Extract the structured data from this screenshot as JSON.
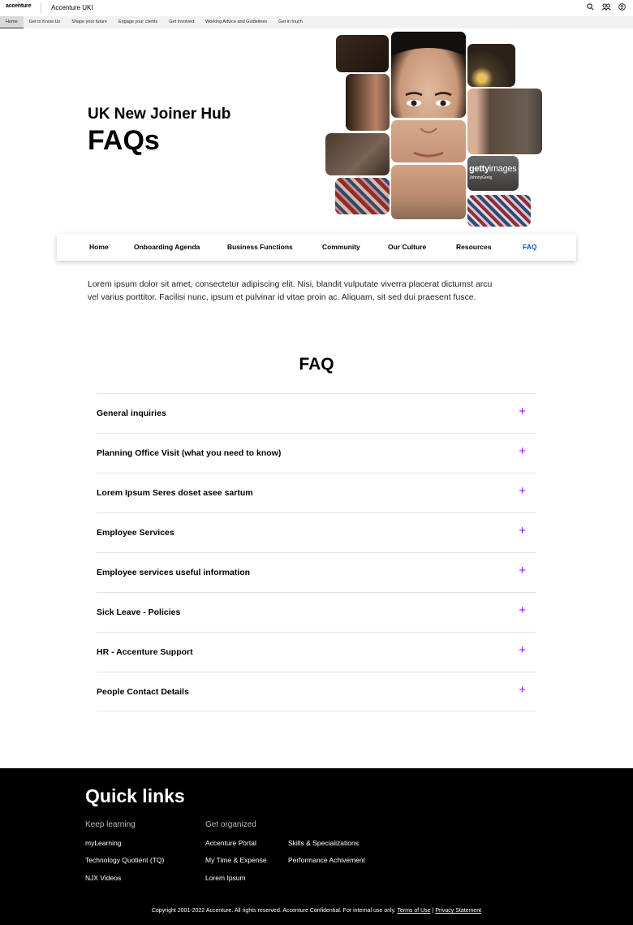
{
  "topbar": {
    "logo_text": "accenture",
    "site_name": "Accenture UKI",
    "icons": [
      "search-icon",
      "people-icon",
      "accessibility-icon"
    ]
  },
  "site_nav": {
    "items": [
      "Home",
      "Get to Know Us",
      "Shape your future",
      "Engage your clients",
      "Get Involved",
      "Working Advice and Guidelines",
      "Get in touch"
    ],
    "active_index": 0
  },
  "hero": {
    "subtitle": "UK New Joiner Hub",
    "title": "FAQs",
    "watermark_brand": "getty",
    "watermark_suffix": "images",
    "watermark_credit": "JohnnyGreig"
  },
  "sub_nav": {
    "items": [
      "Home",
      "Onboarding Agenda",
      "Business Functions",
      "Community",
      "Our Culture",
      "Resources",
      "FAQ"
    ],
    "active_index": 6,
    "active_color": "#0a50d8"
  },
  "intro_text": "Lorem ipsum dolor sit amet, consectetur adipiscing elit. Nisi, blandit vulputate viverra placerat dictumst arcu vel varius porttitor. Facilisi nunc, ipsum et pulvinar id vitae proin ac. Aliquam, sit sed dui praesent fusce.",
  "faq": {
    "title": "FAQ",
    "accent_color": "#a100ff",
    "questions": [
      "General inquiries",
      "Planning Office Visit (what you need to know)",
      "Lorem Ipsum Seres doset asee sartum",
      "Employee Services",
      "Employee services useful information",
      "Sick Leave - Policies",
      "HR - Accenture Support",
      "People Contact Details"
    ],
    "toggle_symbol": "+"
  },
  "footer": {
    "title": "Quick links",
    "keep_learning": {
      "heading": "Keep learning",
      "links": [
        "myLearning",
        "Technology Quotient (TQ)",
        "NJX Videos"
      ]
    },
    "get_organized": {
      "heading": "Get organized",
      "links_col1": [
        "Accenture Portal",
        "My Time & Expense",
        "Lorem Ipsum"
      ],
      "links_col2": [
        "Skills & Specializations",
        "Performance Achivement"
      ]
    },
    "copyright": "Copyright 2001-2022 Accenture. All rights reserved. Accenture Confidential. For internal use only.",
    "terms": "Terms of Use",
    "separator": "|",
    "privacy": "Privacy Statement"
  }
}
